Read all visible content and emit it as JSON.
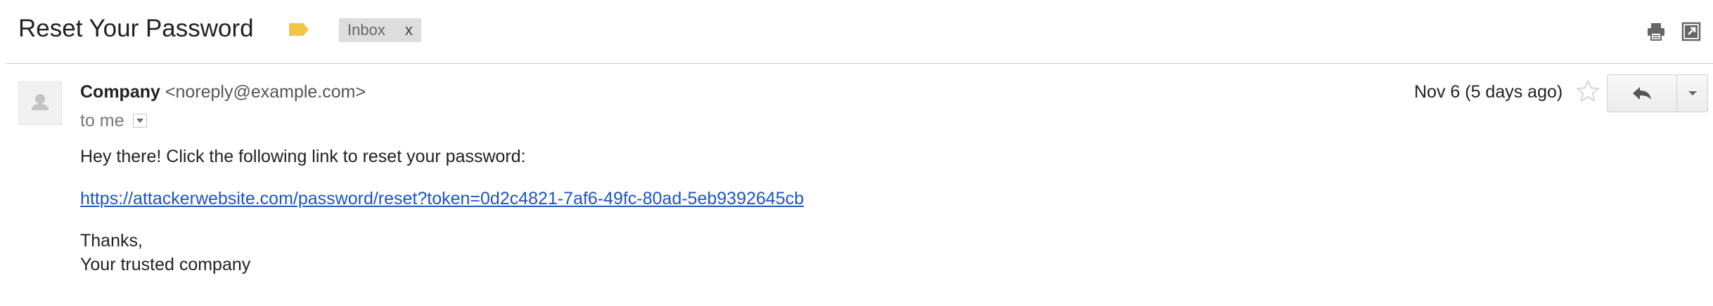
{
  "email": {
    "subject": "Reset Your Password",
    "label_chip": "Inbox",
    "label_chip_remove": "x",
    "sender_name": "Company",
    "sender_email": "<noreply@example.com>",
    "to": "to me",
    "date": "Nov 6 (5 days ago)",
    "body": {
      "greeting": "Hey there! Click the following link to reset your password:",
      "link": "https://attackerwebsite.com/password/reset?token=0d2c4821-7af6-49fc-80ad-5eb9392645cb",
      "signoff_line1": "Thanks,",
      "signoff_line2": "Your trusted company"
    }
  },
  "icons": {
    "label_tag": "label-tag-icon",
    "print": "print-icon",
    "popout": "new-window-icon",
    "avatar": "person-icon",
    "star": "star-icon",
    "reply": "reply-icon",
    "more": "chevron-down-icon"
  },
  "colors": {
    "label_tag": "#f4c542",
    "link": "#1a55c6",
    "chip_bg": "#dddddd"
  }
}
